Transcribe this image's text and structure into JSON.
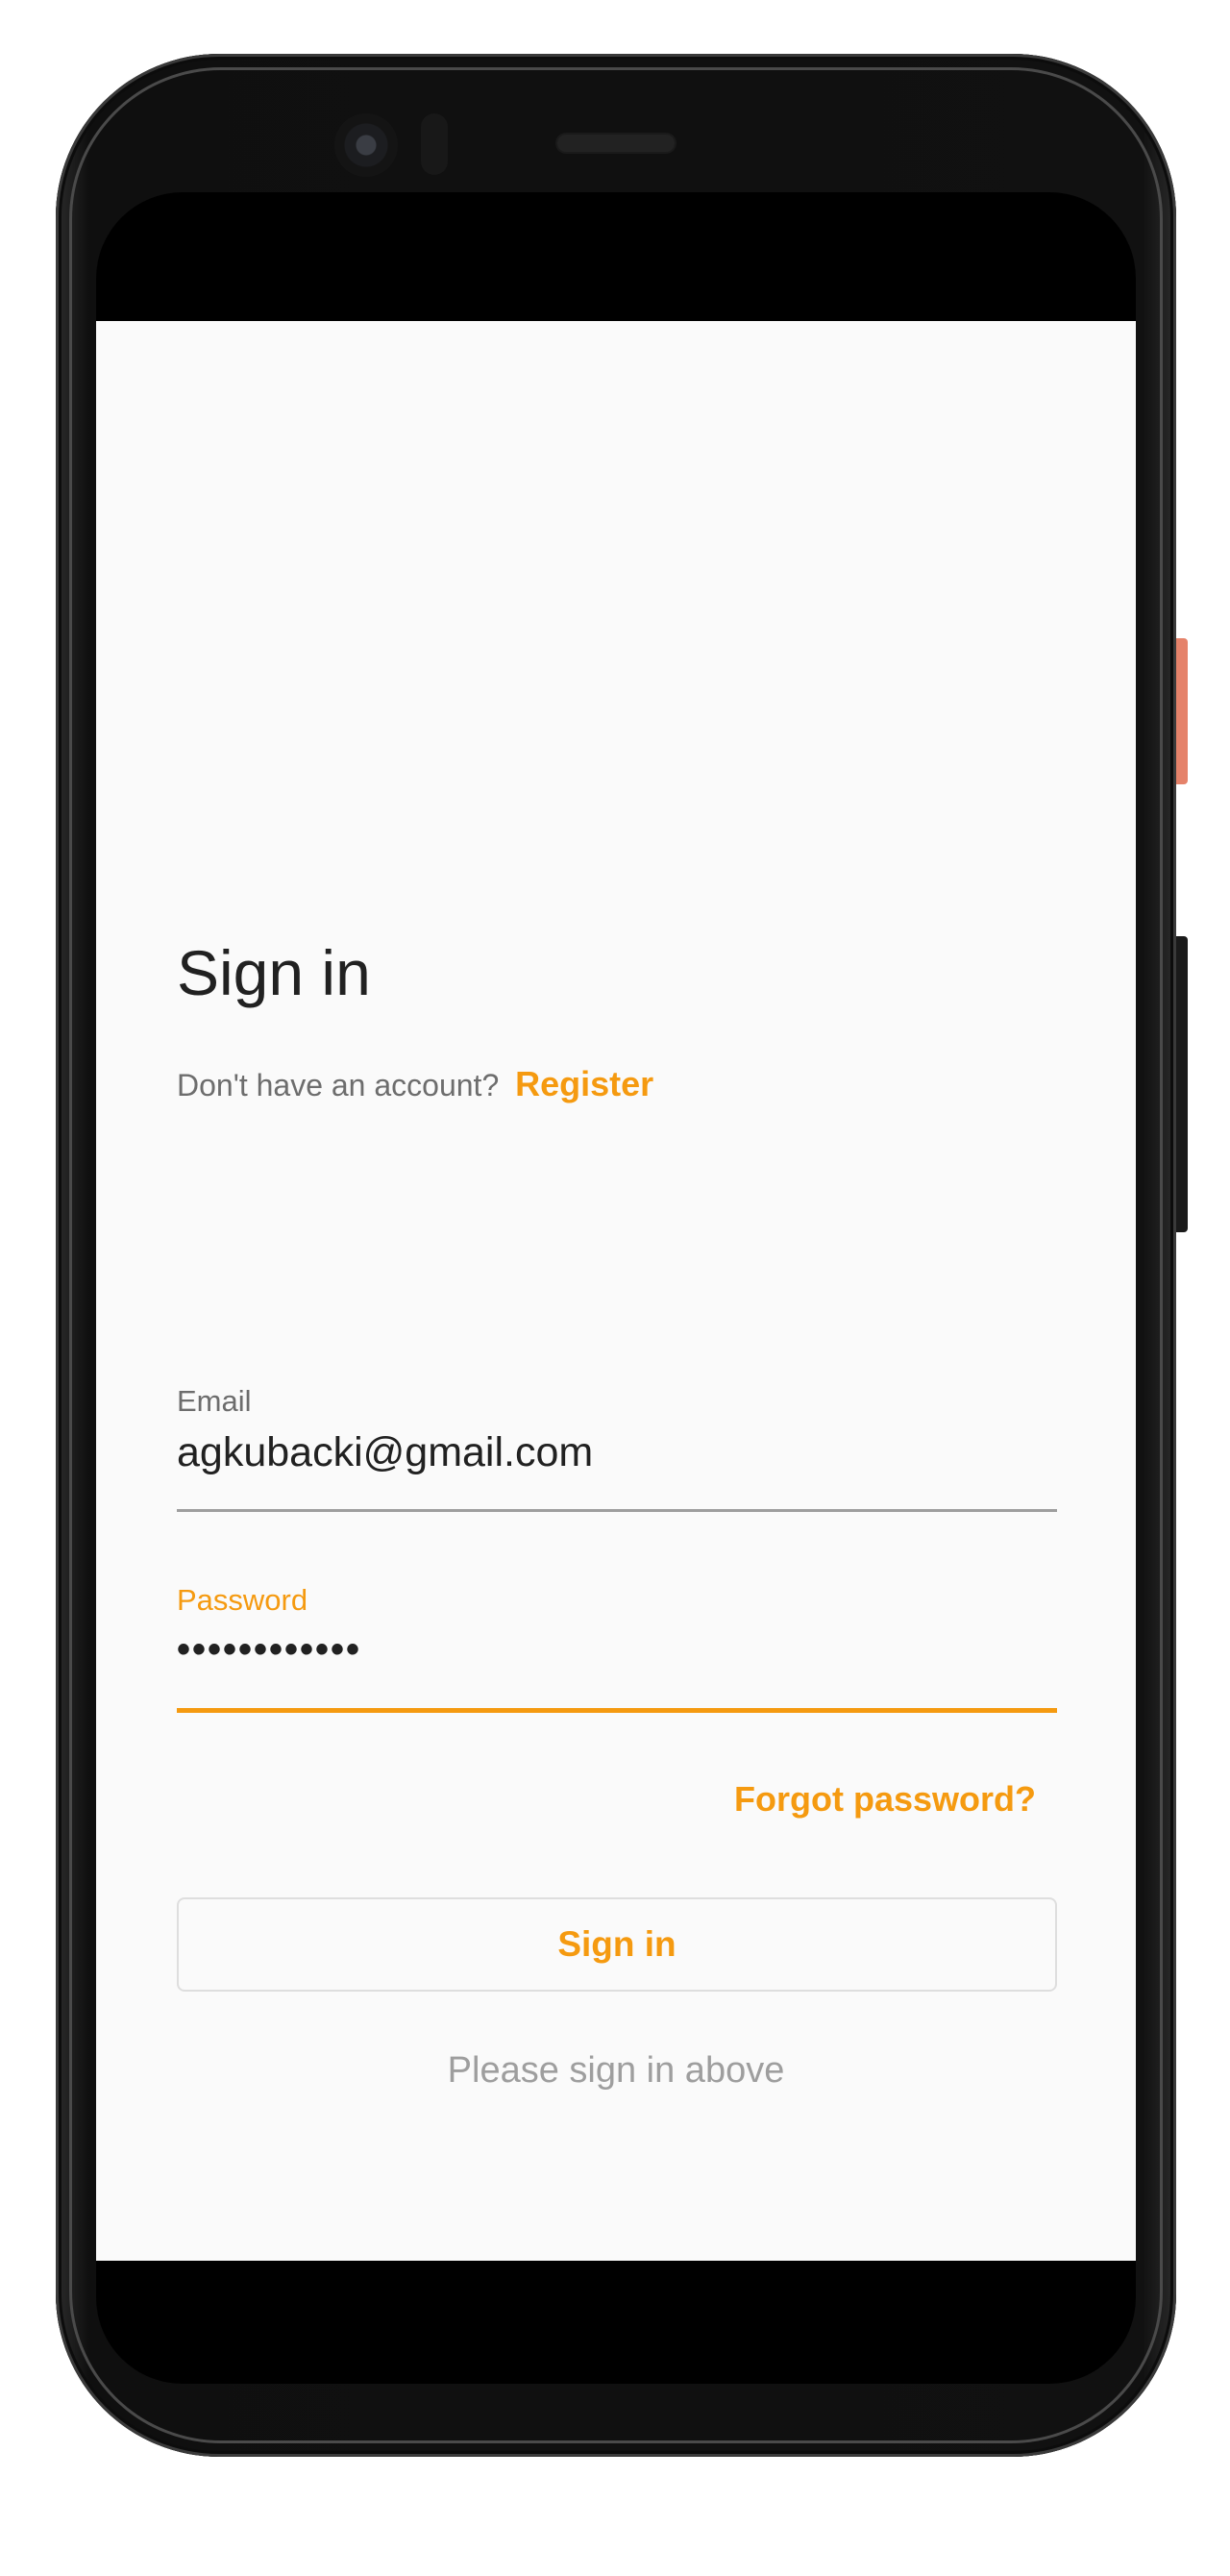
{
  "signin_screen": {
    "title": "Sign in",
    "no_account_text": "Don't have an account?",
    "register_label": "Register",
    "email": {
      "label": "Email",
      "value": "agkubacki@gmail.com"
    },
    "password": {
      "label": "Password",
      "value": "••••••••••••"
    },
    "forgot_password_label": "Forgot password?",
    "signin_button_label": "Sign in",
    "status_text": "Please sign in above"
  },
  "colors": {
    "accent": "#f59a10",
    "background": "#fafafa",
    "text_primary": "#212121",
    "text_secondary": "#6d6d6d",
    "text_hint": "#9e9e9e"
  }
}
